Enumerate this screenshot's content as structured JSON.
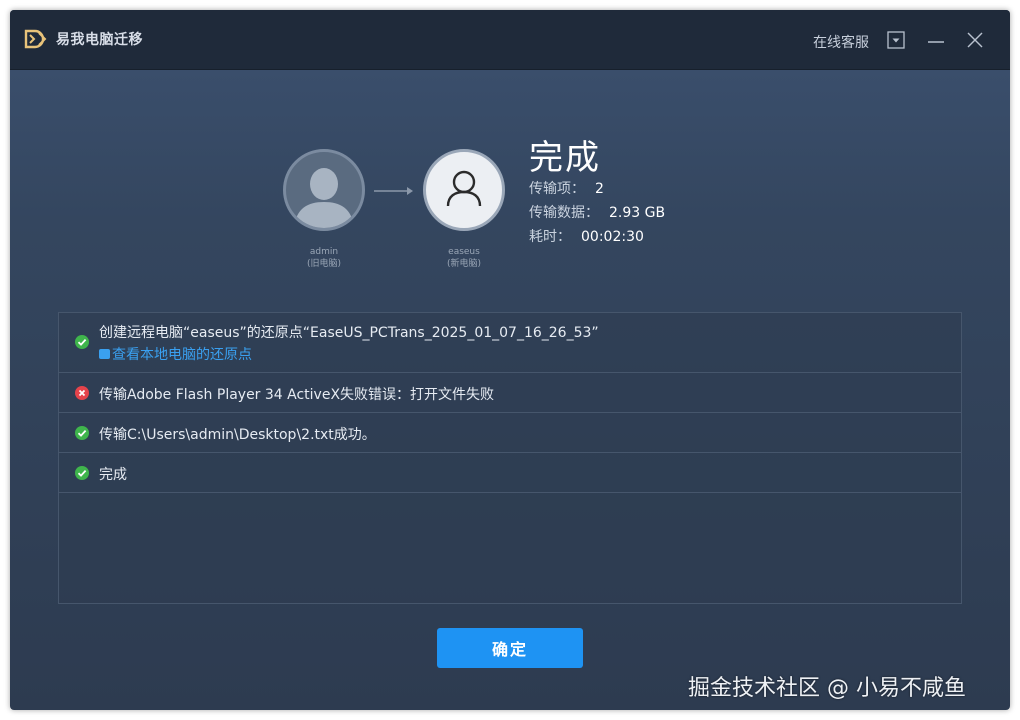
{
  "window": {
    "title": "易我电脑迁移",
    "support_label": "在线客服"
  },
  "transfer": {
    "source": {
      "name": "admin",
      "role": "(旧电脑)"
    },
    "target": {
      "name": "easeus",
      "role": "(新电脑)"
    }
  },
  "summary": {
    "title": "完成",
    "items_label": "传输项：",
    "items_value": "2",
    "data_label": "传输数据：",
    "data_value": "2.93 GB",
    "time_label": "耗时：",
    "time_value": "00:02:30"
  },
  "log": [
    {
      "status": "success",
      "text": "创建远程电脑“easeus”的还原点“EaseUS_PCTrans_2025_01_07_16_26_53”",
      "link": "查看本地电脑的还原点"
    },
    {
      "status": "error",
      "text": "传输Adobe Flash Player 34 ActiveX失败错误：打开文件失败"
    },
    {
      "status": "success",
      "text": "传输C:\\Users\\admin\\Desktop\\2.txt成功。"
    },
    {
      "status": "success",
      "text": "完成"
    }
  ],
  "actions": {
    "confirm_label": "确定"
  },
  "watermark": "掘金技术社区 @ 小易不咸鱼",
  "colors": {
    "accent": "#1e93f3",
    "success": "#3fb54c",
    "error": "#e5434b",
    "link": "#3aa0f0",
    "titlebar": "#1f2a3a"
  }
}
